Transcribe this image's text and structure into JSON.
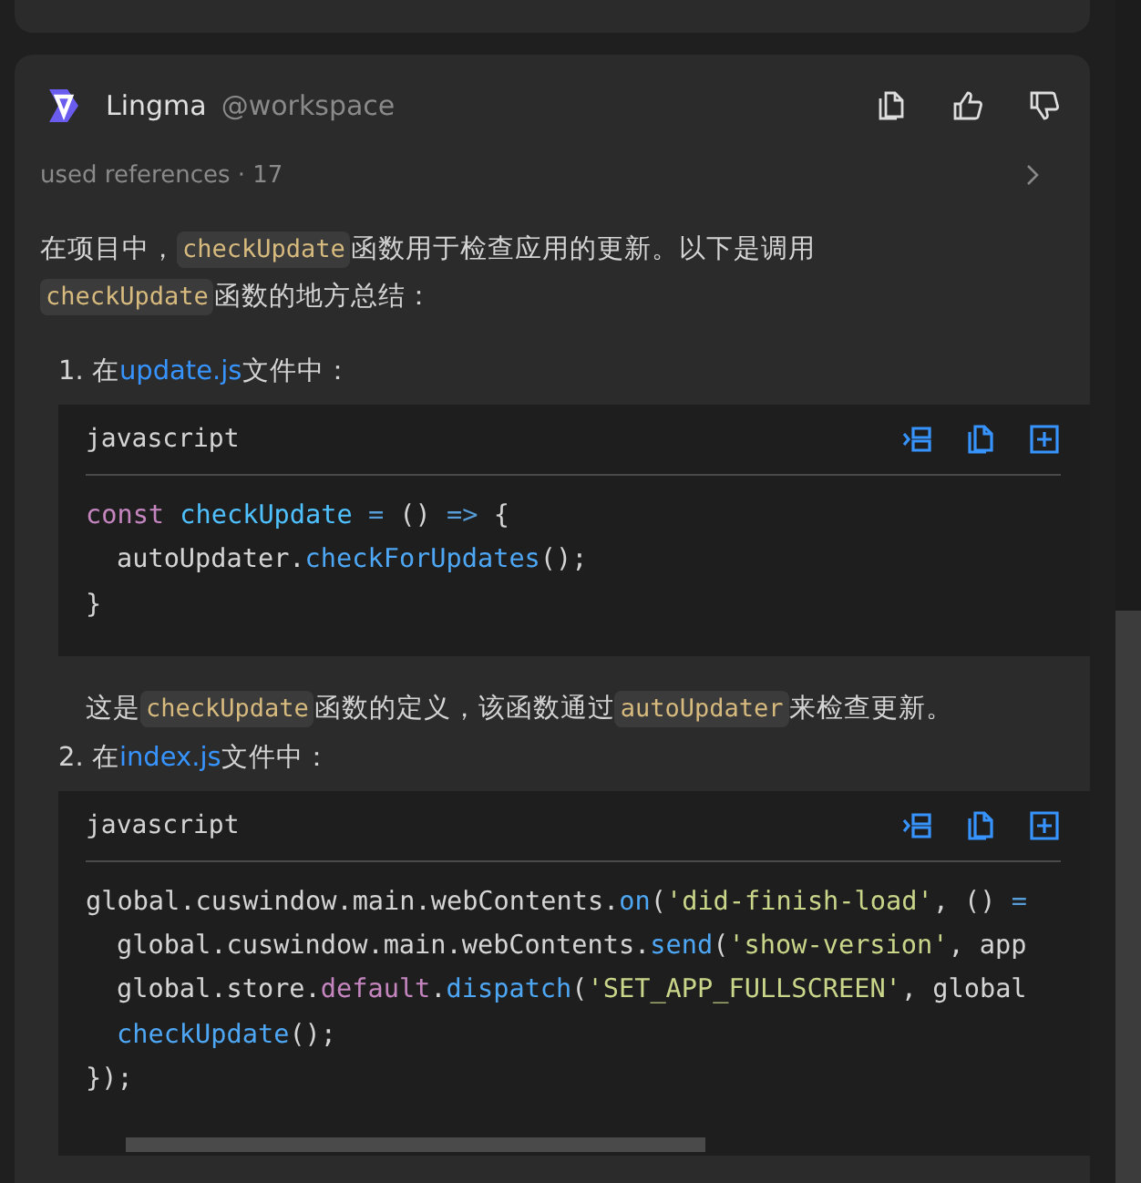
{
  "message": {
    "author": "Lingma",
    "mention": "@workspace",
    "references": {
      "label": "used references · 17",
      "expanded": false
    },
    "intro": [
      {
        "kind": "text",
        "text": "在项目中，"
      },
      {
        "kind": "code",
        "text": "checkUpdate"
      },
      {
        "kind": "text",
        "text": "函数用于检查应用的更新。以下是调用"
      },
      {
        "kind": "code",
        "text": "checkUpdate"
      },
      {
        "kind": "text",
        "text": "函数的地方总结："
      }
    ],
    "steps": [
      {
        "number": "1.",
        "prefix": "在",
        "file": "update.js",
        "suffix": "文件中：",
        "code": {
          "language": "javascript",
          "scrollbar": false,
          "lines": [
            {
              "indented": false,
              "tokens": [
                {
                  "kind": "keyword",
                  "text": "const "
                },
                {
                  "kind": "name",
                  "text": "checkUpdate"
                },
                {
                  "kind": "op",
                  "text": " = "
                },
                {
                  "kind": "plain",
                  "text": "() "
                },
                {
                  "kind": "op",
                  "text": "=>"
                },
                {
                  "kind": "plain",
                  "text": " {"
                }
              ]
            },
            {
              "indented": true,
              "tokens": [
                {
                  "kind": "plain",
                  "text": "autoUpdater."
                },
                {
                  "kind": "func",
                  "text": "checkForUpdates"
                },
                {
                  "kind": "plain",
                  "text": "();"
                }
              ]
            },
            {
              "indented": false,
              "tokens": [
                {
                  "kind": "plain",
                  "text": "}"
                }
              ]
            }
          ]
        },
        "note": [
          {
            "kind": "text",
            "text": "这是"
          },
          {
            "kind": "code",
            "text": "checkUpdate"
          },
          {
            "kind": "text",
            "text": "函数的定义，该函数通过"
          },
          {
            "kind": "code",
            "text": "autoUpdater"
          },
          {
            "kind": "text",
            "text": "来检查更新。"
          }
        ]
      },
      {
        "number": "2.",
        "prefix": "在",
        "file": "index.js",
        "suffix": "文件中：",
        "code": {
          "language": "javascript",
          "scrollbar": true,
          "lines": [
            {
              "indented": false,
              "tokens": [
                {
                  "kind": "plain",
                  "text": "global.cuswindow.main.webContents."
                },
                {
                  "kind": "func",
                  "text": "on"
                },
                {
                  "kind": "plain",
                  "text": "("
                },
                {
                  "kind": "string",
                  "text": "'did-finish-load'"
                },
                {
                  "kind": "plain",
                  "text": ", () "
                },
                {
                  "kind": "op",
                  "text": "="
                }
              ]
            },
            {
              "indented": true,
              "tokens": [
                {
                  "kind": "plain",
                  "text": "global.cuswindow.main.webContents."
                },
                {
                  "kind": "func",
                  "text": "send"
                },
                {
                  "kind": "plain",
                  "text": "("
                },
                {
                  "kind": "string",
                  "text": "'show-version'"
                },
                {
                  "kind": "plain",
                  "text": ", app"
                }
              ]
            },
            {
              "indented": true,
              "tokens": [
                {
                  "kind": "plain",
                  "text": "global.store."
                },
                {
                  "kind": "keyword",
                  "text": "default"
                },
                {
                  "kind": "plain",
                  "text": "."
                },
                {
                  "kind": "func",
                  "text": "dispatch"
                },
                {
                  "kind": "plain",
                  "text": "("
                },
                {
                  "kind": "string",
                  "text": "'SET_APP_FULLSCREEN'"
                },
                {
                  "kind": "plain",
                  "text": ", global"
                }
              ]
            },
            {
              "indented": true,
              "tokens": [
                {
                  "kind": "func",
                  "text": "checkUpdate"
                },
                {
                  "kind": "plain",
                  "text": "();"
                }
              ]
            },
            {
              "indented": false,
              "tokens": [
                {
                  "kind": "plain",
                  "text": "});"
                }
              ]
            }
          ]
        }
      }
    ]
  }
}
